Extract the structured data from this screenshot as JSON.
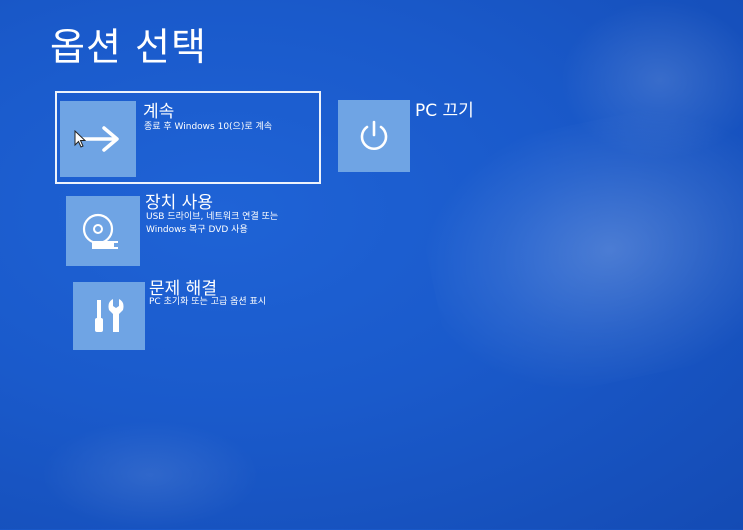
{
  "screen": {
    "title": "옵션 선택"
  },
  "options": [
    {
      "label": "계속",
      "description": "종료 후 Windows 10(으)로 계속",
      "icon": "arrow-right-icon"
    },
    {
      "label": "PC 끄기",
      "description": "",
      "icon": "power-icon"
    },
    {
      "label": "장치 사용",
      "description": "USB 드라이브, 네트워크 연결 또는\nWindows 복구 DVD 사용",
      "icon": "disc-drive-icon"
    },
    {
      "label": "문제 해결",
      "description": "PC 초기화 또는 고급 옵션 표시",
      "icon": "tools-icon"
    }
  ],
  "colors": {
    "background": "#1a5acb",
    "tile": "#6fa4e4",
    "text": "#ffffff"
  }
}
